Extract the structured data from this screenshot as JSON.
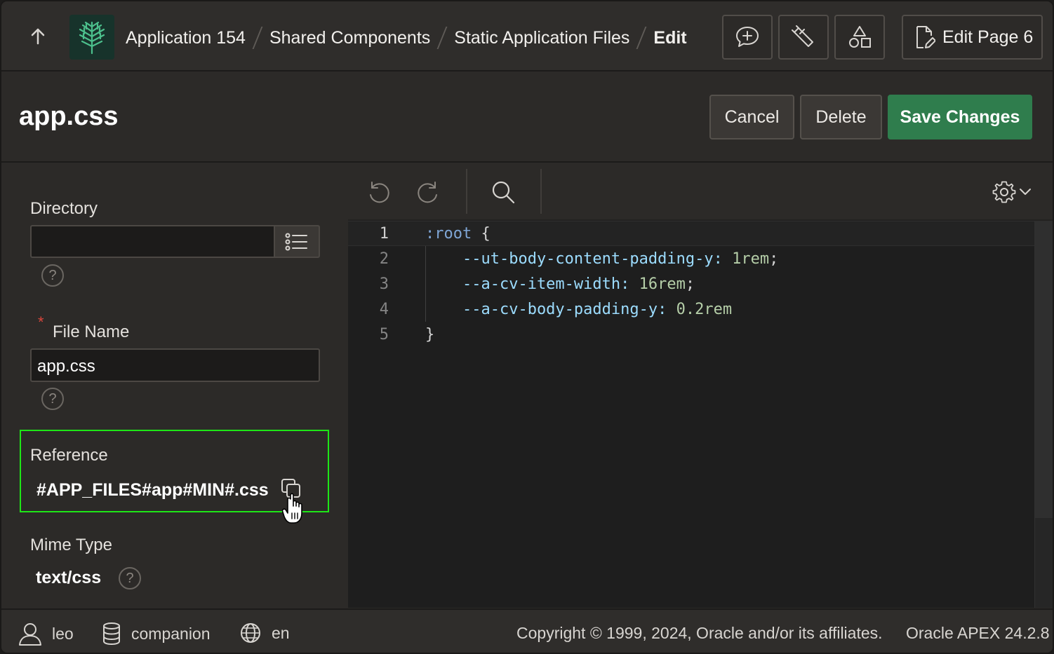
{
  "header": {
    "breadcrumbs": [
      {
        "label": "Application 154"
      },
      {
        "label": "Shared Components"
      },
      {
        "label": "Static Application Files"
      },
      {
        "label": "Edit"
      }
    ],
    "toolbar_icons": [
      "add-comment-icon",
      "clean-tool-icon",
      "shared-components-icon"
    ],
    "edit_page_label": "Edit Page 6"
  },
  "title_bar": {
    "title": "app.css",
    "cancel_label": "Cancel",
    "delete_label": "Delete",
    "save_label": "Save Changes"
  },
  "form": {
    "directory": {
      "label": "Directory",
      "value": ""
    },
    "file_name": {
      "label": "File Name",
      "required_mark": "*",
      "value": "app.css"
    },
    "reference": {
      "label": "Reference",
      "value": "#APP_FILES#app#MIN#.css"
    },
    "mime_type": {
      "label": "Mime Type",
      "value": "text/css"
    },
    "help_glyph": "?"
  },
  "editor": {
    "lines": [
      {
        "number": "1",
        "tokens": [
          {
            "t": ":root",
            "c": "sel"
          },
          {
            "t": " {",
            "c": "punc"
          }
        ]
      },
      {
        "number": "2",
        "tokens": [
          {
            "t": "    --ut-body-content-padding-y:",
            "c": "prop"
          },
          {
            "t": " 1rem",
            "c": "num"
          },
          {
            "t": ";",
            "c": "punc"
          }
        ]
      },
      {
        "number": "3",
        "tokens": [
          {
            "t": "    --a-cv-item-width:",
            "c": "prop"
          },
          {
            "t": " 16rem",
            "c": "num"
          },
          {
            "t": ";",
            "c": "punc"
          }
        ]
      },
      {
        "number": "4",
        "tokens": [
          {
            "t": "    --a-cv-body-padding-y:",
            "c": "prop"
          },
          {
            "t": " 0.2rem",
            "c": "num"
          }
        ]
      },
      {
        "number": "5",
        "tokens": [
          {
            "t": "}",
            "c": "punc"
          }
        ]
      }
    ]
  },
  "footer": {
    "user": "leo",
    "workspace": "companion",
    "language": "en",
    "copyright": "Copyright © 1999, 2024, Oracle and/or its affiliates.",
    "version": "Oracle APEX 24.2.8"
  },
  "colors": {
    "accent_save": "#2f7d4d",
    "highlight_box": "#1ee617",
    "required": "#d9463c"
  }
}
